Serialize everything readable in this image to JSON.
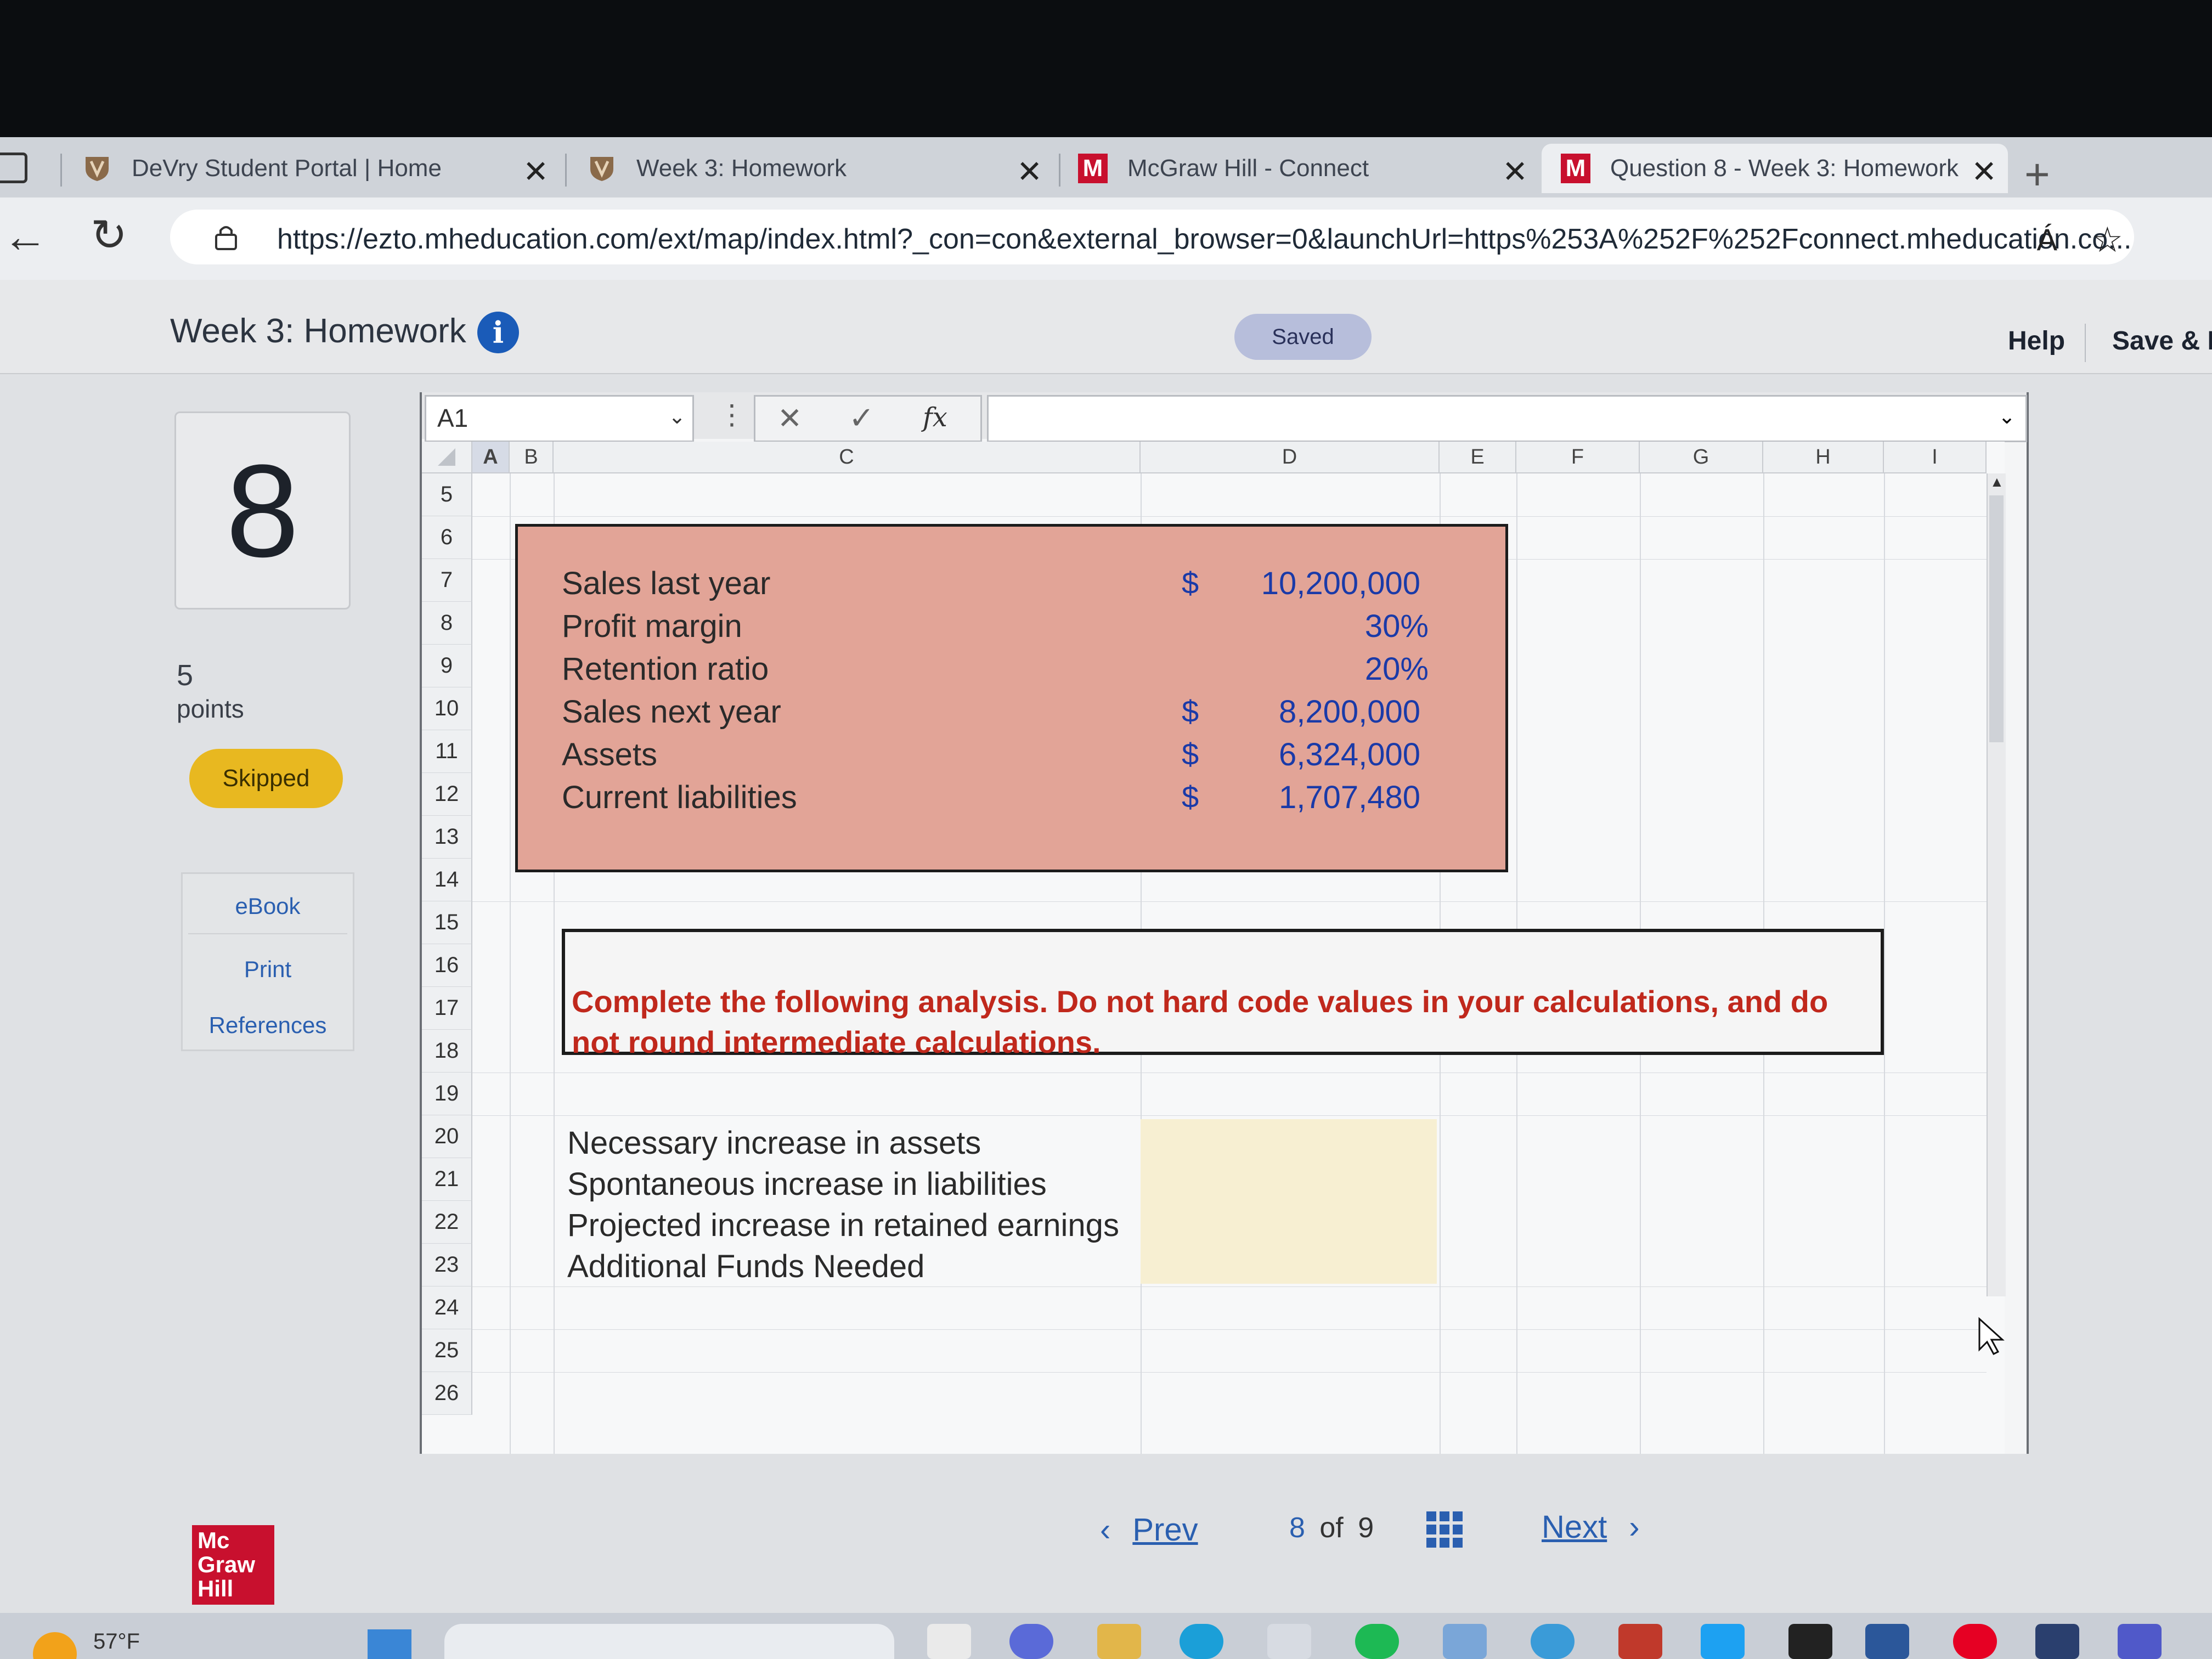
{
  "browser": {
    "tabs": [
      {
        "label": "DeVry Student Portal | Home"
      },
      {
        "label": "Week 3: Homework"
      },
      {
        "label": "McGraw Hill - Connect"
      },
      {
        "label": "Question 8 - Week 3: Homework"
      }
    ],
    "url": "https://ezto.mheducation.com/ext/map/index.html?_con=con&external_browser=0&launchUrl=https%253A%252F%252Fconnect.mheducation.co...",
    "read_aloud": "Á"
  },
  "header": {
    "title": "Week 3: Homework",
    "status": "Saved",
    "help": "Help",
    "save_exit": "Save & E"
  },
  "question": {
    "number": "8",
    "points_value": "5",
    "points_label": "points",
    "status": "Skipped"
  },
  "side_links": [
    "eBook",
    "Print",
    "References"
  ],
  "spreadsheet": {
    "name_box": "A1",
    "fx_label": "fx",
    "columns": [
      "A",
      "B",
      "C",
      "D",
      "E",
      "F",
      "G",
      "H",
      "I"
    ],
    "rows": [
      "5",
      "6",
      "7",
      "8",
      "9",
      "10",
      "11",
      "12",
      "13",
      "14",
      "15",
      "16",
      "17",
      "18",
      "19",
      "20",
      "21",
      "22",
      "23",
      "24",
      "25",
      "26"
    ],
    "inputs": [
      {
        "label": "Sales last year",
        "currency": "$",
        "value": "10,200,000"
      },
      {
        "label": "Profit margin",
        "currency": "",
        "value": "30%"
      },
      {
        "label": "Retention ratio",
        "currency": "",
        "value": "20%"
      },
      {
        "label": "Sales next year",
        "currency": "$",
        "value": "8,200,000"
      },
      {
        "label": "Assets",
        "currency": "$",
        "value": "6,324,000"
      },
      {
        "label": "Current liabilities",
        "currency": "$",
        "value": "1,707,480"
      }
    ],
    "instruction": "Complete the following analysis. Do not hard code values in your calculations, and do not round intermediate calculations.",
    "analysis": [
      "Necessary increase in assets",
      "Spontaneous increase in liabilities",
      "Projected increase in retained earnings",
      "Additional Funds Needed"
    ]
  },
  "nav": {
    "prev": "Prev",
    "current": "8",
    "of": "of",
    "total": "9",
    "next": "Next"
  },
  "brand": {
    "logo": "Mc Graw Hill"
  },
  "taskbar": {
    "weather": "57°F"
  },
  "colors": {
    "accent": "#2a5fb0",
    "skipped": "#e8b820",
    "input_box": "#e2a497",
    "instruction": "#c0281c",
    "brand": "#c8102e"
  }
}
